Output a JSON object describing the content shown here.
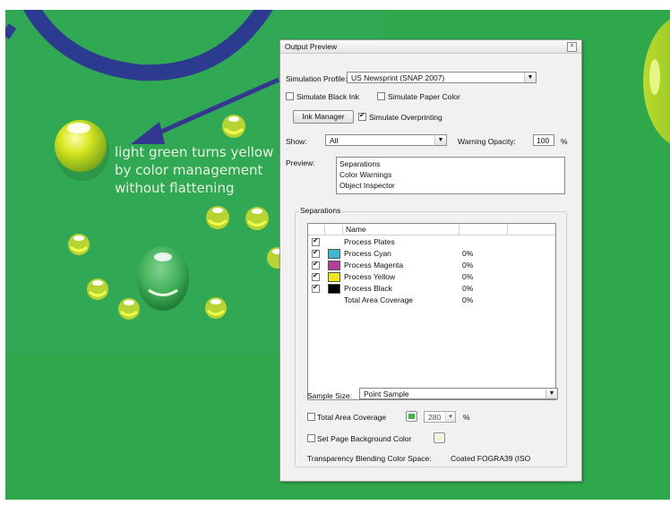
{
  "artwork": {
    "caption_lines": [
      "light green turns yellow",
      "by color management",
      "without flattening"
    ]
  },
  "panel": {
    "title": "Output Preview",
    "simulation_profile_label": "Simulation Profile:",
    "simulation_profile_value": "US Newsprint (SNAP 2007)",
    "simulate_black_ink": {
      "label": "Simulate Black Ink",
      "checked": false
    },
    "simulate_paper_color": {
      "label": "Simulate Paper Color",
      "checked": false
    },
    "ink_manager_label": "Ink Manager",
    "simulate_overprinting": {
      "label": "Simulate Overprinting",
      "checked": true
    },
    "show_label": "Show:",
    "show_value": "All",
    "warning_opacity_label": "Warning Opacity:",
    "warning_opacity_value": "100",
    "warning_opacity_unit": "%",
    "preview_label": "Preview:",
    "preview_items": [
      "Separations",
      "Color Warnings",
      "Object Inspector"
    ],
    "separations_label": "Separations",
    "table": {
      "name_header": "Name",
      "rows": [
        {
          "name": "Process Plates",
          "checked": true,
          "swatch": "",
          "percent": ""
        },
        {
          "name": "Process Cyan",
          "checked": true,
          "swatch": "#3fb6d2",
          "percent": "0%"
        },
        {
          "name": "Process Magenta",
          "checked": true,
          "swatch": "#b03f9a",
          "percent": "0%"
        },
        {
          "name": "Process Yellow",
          "checked": true,
          "swatch": "#f1e51b",
          "percent": "0%"
        },
        {
          "name": "Process Black",
          "checked": true,
          "swatch": "#000000",
          "percent": "0%"
        },
        {
          "name": "Total Area Coverage",
          "checked": false,
          "swatch": "",
          "percent": "0%"
        }
      ]
    },
    "sample_size_label": "Sample Size:",
    "sample_size_value": "Point Sample",
    "total_area_coverage": {
      "label": "Total Area Coverage",
      "checked": false,
      "value": "280",
      "unit": "%",
      "swatch": "#3db54a"
    },
    "set_page_background": {
      "label": "Set Page Background Color",
      "checked": false,
      "swatch": "#f4f2c8"
    },
    "blending_label": "Transparency Blending Color Space:",
    "blending_value": "Coated FOGRA39 (ISO"
  }
}
